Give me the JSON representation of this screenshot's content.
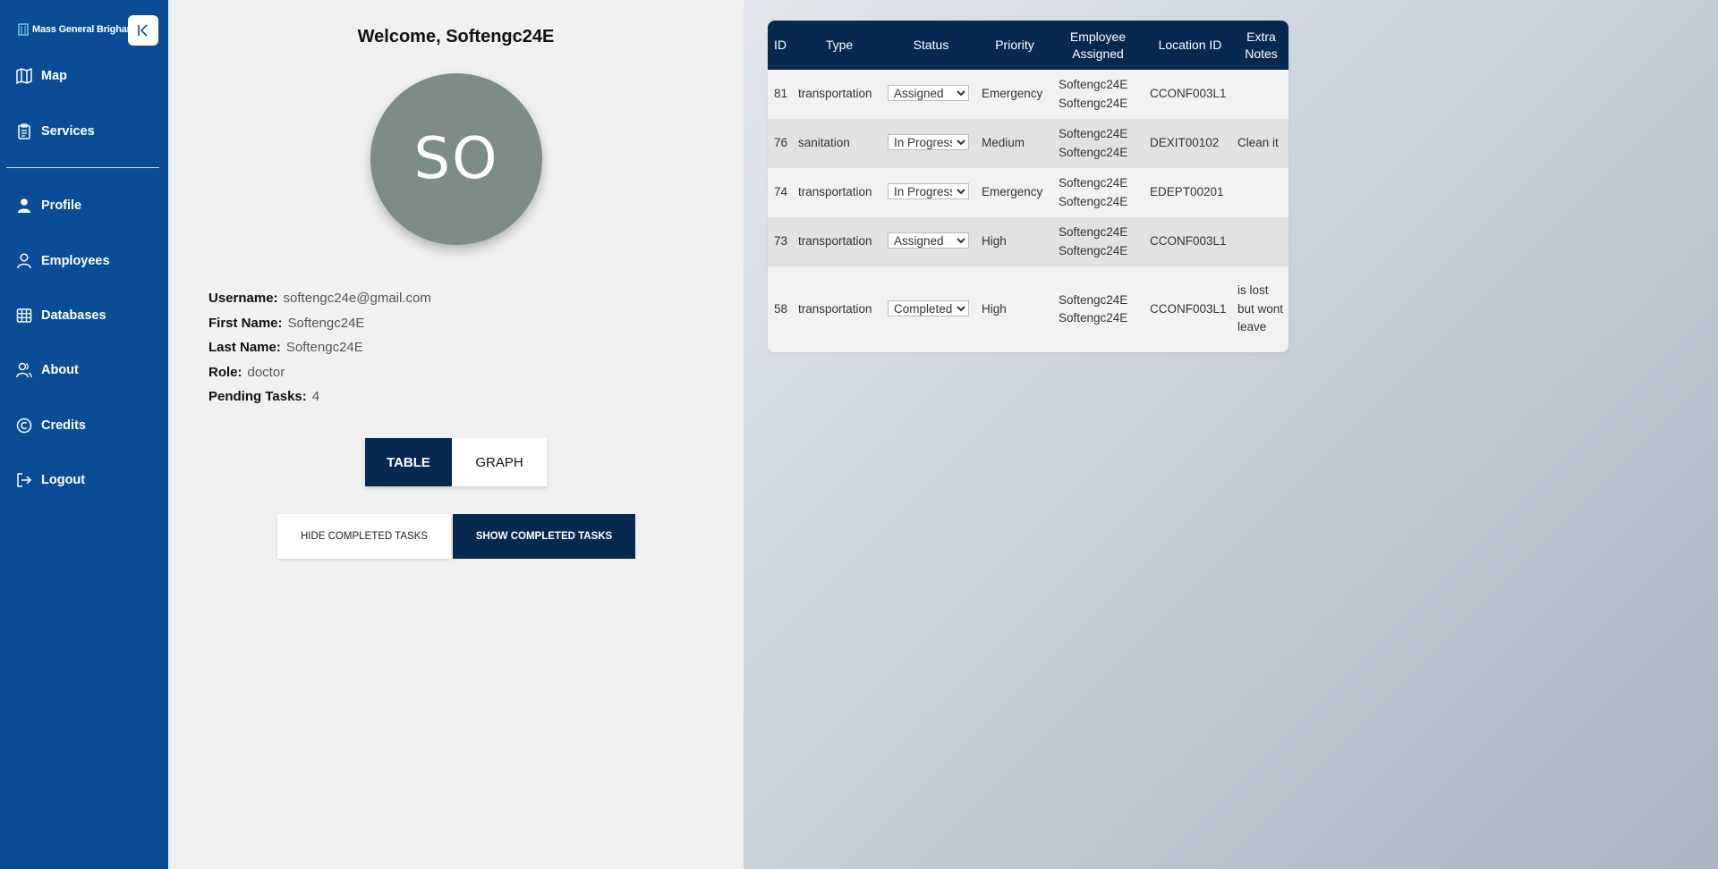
{
  "sidebar": {
    "brand": "Mass General Brigham",
    "items": [
      {
        "label": "Map",
        "icon": "map-icon"
      },
      {
        "label": "Services",
        "icon": "clipboard-icon"
      },
      {
        "label": "Profile",
        "icon": "user-icon"
      },
      {
        "label": "Employees",
        "icon": "person-icon"
      },
      {
        "label": "Databases",
        "icon": "table-icon"
      },
      {
        "label": "About",
        "icon": "users-icon"
      },
      {
        "label": "Credits",
        "icon": "copyright-icon"
      },
      {
        "label": "Logout",
        "icon": "logout-icon"
      }
    ]
  },
  "profile": {
    "welcome": "Welcome, Softengc24E",
    "initials": "SO",
    "fields": [
      {
        "label": "Username:",
        "value": "softengc24e@gmail.com"
      },
      {
        "label": "First Name:",
        "value": "Softengc24E"
      },
      {
        "label": "Last Name:",
        "value": "Softengc24E"
      },
      {
        "label": "Role:",
        "value": "doctor"
      },
      {
        "label": "Pending Tasks:",
        "value": "4"
      }
    ],
    "view_toggle": {
      "table": "TABLE",
      "graph": "GRAPH"
    },
    "task_toggle": {
      "hide": "HIDE COMPLETED TASKS",
      "show": "SHOW COMPLETED TASKS"
    }
  },
  "table": {
    "headers": [
      "ID",
      "Type",
      "Status",
      "Priority",
      "Employee Assigned",
      "Location ID",
      "Extra Notes"
    ],
    "status_options": [
      "Assigned",
      "In Progress",
      "Completed"
    ],
    "rows": [
      {
        "id": "81",
        "type": "transportation",
        "status": "Assigned",
        "priority": "Emergency",
        "emp1": "Softengc24E",
        "emp2": "Softengc24E",
        "location": "CCONF003L1",
        "notes": ""
      },
      {
        "id": "76",
        "type": "sanitation",
        "status": "In Progress",
        "priority": "Medium",
        "emp1": "Softengc24E",
        "emp2": "Softengc24E",
        "location": "DEXIT00102",
        "notes": "Clean it"
      },
      {
        "id": "74",
        "type": "transportation",
        "status": "In Progress",
        "priority": "Emergency",
        "emp1": "Softengc24E",
        "emp2": "Softengc24E",
        "location": "EDEPT00201",
        "notes": ""
      },
      {
        "id": "73",
        "type": "transportation",
        "status": "Assigned",
        "priority": "High",
        "emp1": "Softengc24E",
        "emp2": "Softengc24E",
        "location": "CCONF003L1",
        "notes": ""
      },
      {
        "id": "58",
        "type": "transportation",
        "status": "Completed",
        "priority": "High",
        "emp1": "Softengc24E",
        "emp2": "Softengc24E",
        "location": "CCONF003L1",
        "notes": "is lost but wont leave"
      }
    ]
  },
  "colors": {
    "sidebar": "#0a4d96",
    "navy": "#08294f",
    "avatar": "#7d8b89"
  }
}
